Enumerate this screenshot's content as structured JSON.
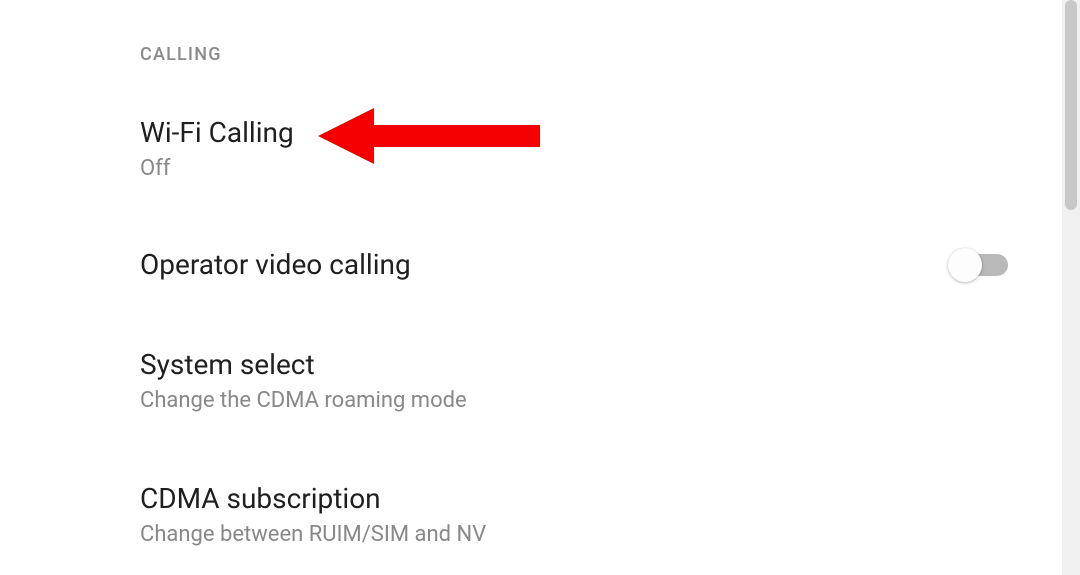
{
  "section": {
    "header": "CALLING"
  },
  "settings": {
    "wifi_calling": {
      "title": "Wi-Fi Calling",
      "subtitle": "Off"
    },
    "video_calling": {
      "title": "Operator video calling",
      "enabled": false
    },
    "system_select": {
      "title": "System select",
      "subtitle": "Change the CDMA roaming mode"
    },
    "cdma_subscription": {
      "title": "CDMA subscription",
      "subtitle": "Change between RUIM/SIM and NV"
    }
  },
  "annotation": {
    "arrow_color": "#f40000"
  }
}
